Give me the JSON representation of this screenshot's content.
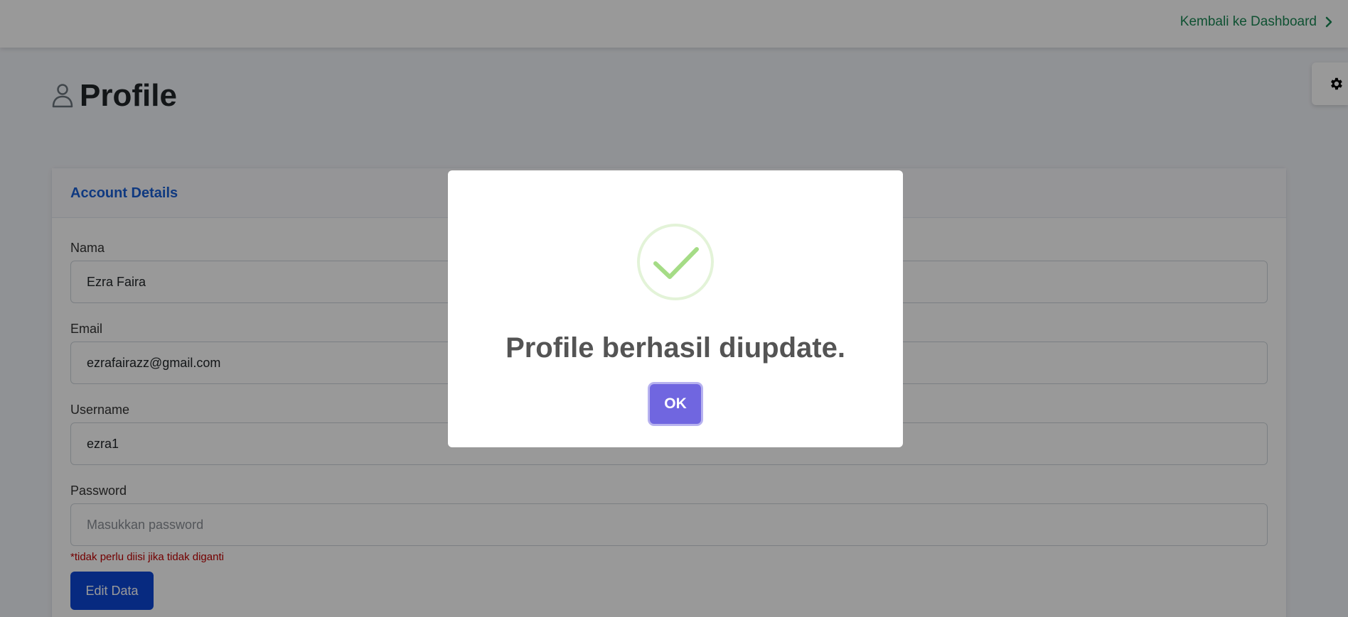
{
  "header": {
    "back_link": "Kembali ke Dashboard"
  },
  "page": {
    "title": "Profile"
  },
  "card": {
    "title": "Account Details",
    "fields": [
      {
        "label": "Nama",
        "value": "Ezra Faira",
        "placeholder": ""
      },
      {
        "label": "Email",
        "value": "ezrafairazz@gmail.com",
        "placeholder": ""
      },
      {
        "label": "Username",
        "value": "ezra1",
        "placeholder": ""
      },
      {
        "label": "Password",
        "value": "",
        "placeholder": "Masukkan password"
      }
    ],
    "password_hint": "*tidak perlu diisi jika tidak diganti",
    "edit_button": "Edit Data"
  },
  "modal": {
    "message": "Profile berhasil diupdate.",
    "ok_button": "OK",
    "icon": "success-check-icon"
  },
  "colors": {
    "accent": "#0d47d6",
    "link": "#198754",
    "modal_button": "#7066e0",
    "success": "#a5dc86",
    "hint": "#c00000"
  }
}
